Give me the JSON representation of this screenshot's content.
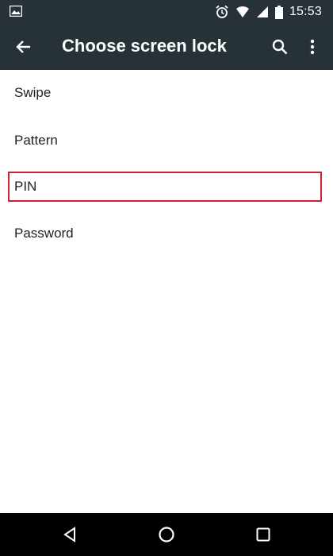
{
  "status_bar": {
    "time": "15:53",
    "icons": [
      "image-notification-icon",
      "alarm-icon",
      "wifi-icon",
      "signal-icon",
      "battery-icon"
    ]
  },
  "app_bar": {
    "title": "Choose screen lock",
    "icons": [
      "back-arrow-icon",
      "search-icon",
      "more-vert-icon"
    ]
  },
  "options": [
    {
      "label": "Swipe"
    },
    {
      "label": "Pattern"
    },
    {
      "label": "PIN"
    },
    {
      "label": "Password"
    }
  ],
  "highlighted_option": "PIN",
  "nav_bar": {
    "icons": [
      "back-triangle-icon",
      "home-circle-icon",
      "recents-square-icon"
    ]
  },
  "colors": {
    "toolbar": "#263238",
    "highlight_border": "#d01f30",
    "text": "#212121",
    "background": "#ffffff"
  }
}
